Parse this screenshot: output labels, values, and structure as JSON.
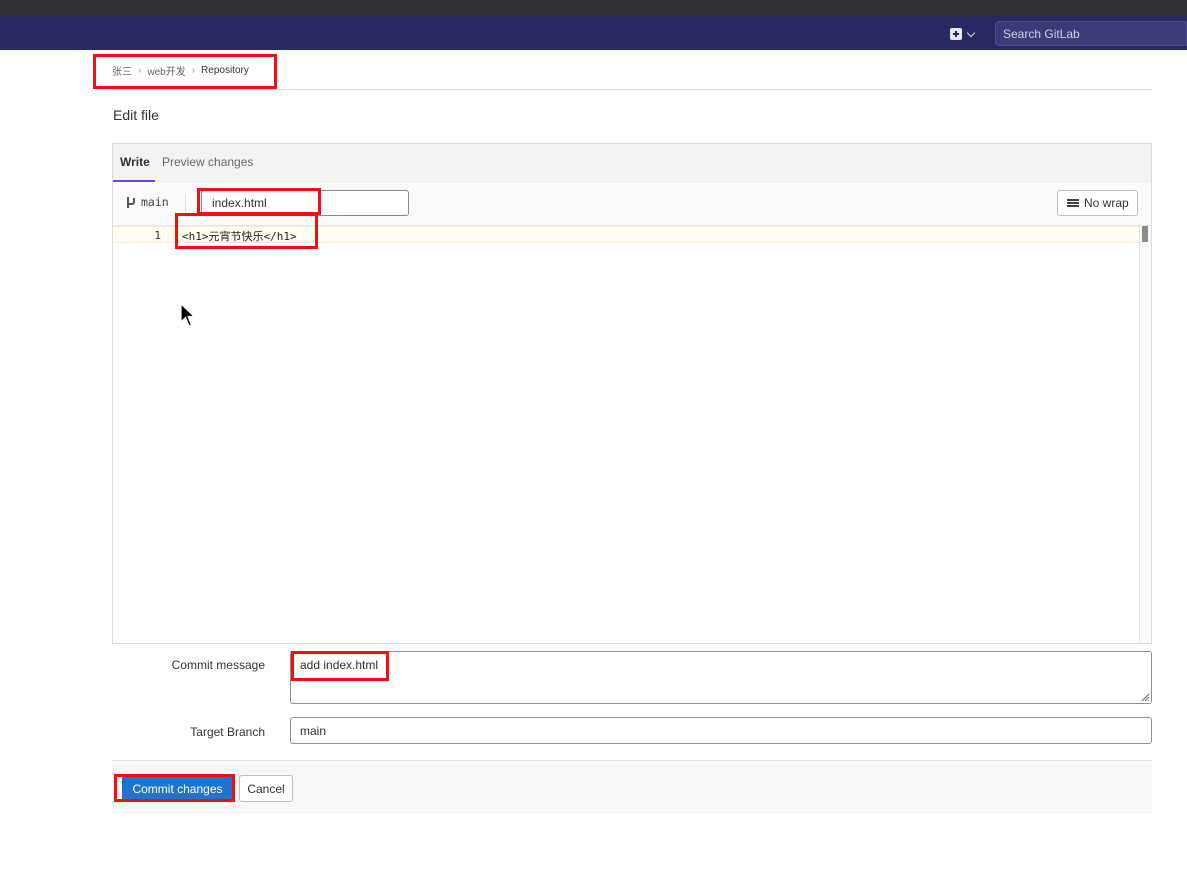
{
  "navbar": {
    "new_icon": "plus-square-icon",
    "search_placeholder": "Search GitLab"
  },
  "breadcrumb": {
    "items": [
      "张三",
      "web开发",
      "Repository"
    ]
  },
  "page": {
    "title": "Edit file"
  },
  "editor": {
    "tabs": [
      {
        "label": "Write",
        "active": true
      },
      {
        "label": "Preview changes",
        "active": false
      }
    ],
    "branch": "main",
    "file_name": "index.html",
    "wrap_button": "No wrap",
    "lines": [
      {
        "number": "1",
        "text": "<h1>元宵节快乐</h1>"
      }
    ]
  },
  "form": {
    "commit_message_label": "Commit message",
    "commit_message_value": "add index.html",
    "target_branch_label": "Target Branch",
    "target_branch_value": "main"
  },
  "actions": {
    "commit_label": "Commit changes",
    "cancel_label": "Cancel"
  },
  "colors": {
    "navbar": "#292961",
    "primary_button": "#1f75cb",
    "highlight_box": "#ee1111",
    "active_tab_underline": "#6e49cb"
  }
}
